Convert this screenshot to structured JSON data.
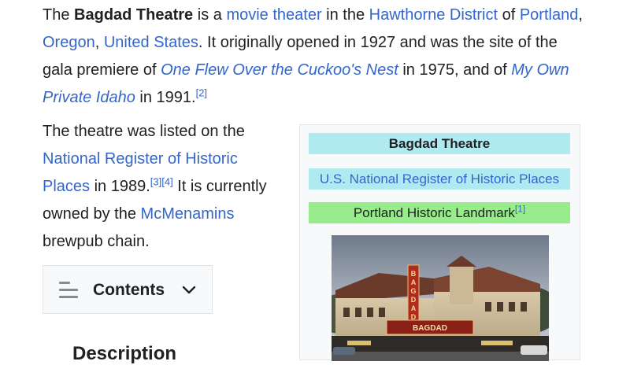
{
  "intro": {
    "p1": "The ",
    "title_bold": "Bagdad Theatre",
    "p2": " is a ",
    "link_movie_theater": "movie theater",
    "p3": " in the ",
    "link_hawthorne": "Hawthorne District",
    "p4": " of ",
    "link_portland": "Portland",
    "p5": ", ",
    "link_oregon": "Oregon",
    "p6": ", ",
    "link_us": "United States",
    "p7": ". It originally opened in 1927 and was the site of the gala premiere of ",
    "link_cuckoo": "One Flew Over the Cuckoo's Nest",
    "p8": " in 1975, and of ",
    "link_idaho": "My Own Private Idaho",
    "p9": " in 1991.",
    "ref_2": "[2]"
  },
  "para2": {
    "p1": "The theatre was listed on the ",
    "link_nrhp": "National Register of Historic Places",
    "p2": " in 1989.",
    "ref_3": "[3]",
    "ref_4": "[4]",
    "p3": " It is currently owned by the ",
    "link_mcmenamins": "McMenamins",
    "p4": " brewpub chain."
  },
  "infobox": {
    "title": "Bagdad Theatre",
    "nrhp_label": "U.S. National Register of Historic Places",
    "landmark_label": "Portland Historic Landmark",
    "landmark_ref": "[1]",
    "marquee_text": "BAGDAD",
    "vertical_sign": "BAGDAD",
    "colors": {
      "title_bg": "#b0eaf0",
      "landmark_bg": "#98ec8c"
    }
  },
  "toc": {
    "label": "Contents",
    "icon": "hamburger-icon",
    "toggle_icon": "chevron-down-icon"
  },
  "next_heading": {
    "text": "Description"
  }
}
